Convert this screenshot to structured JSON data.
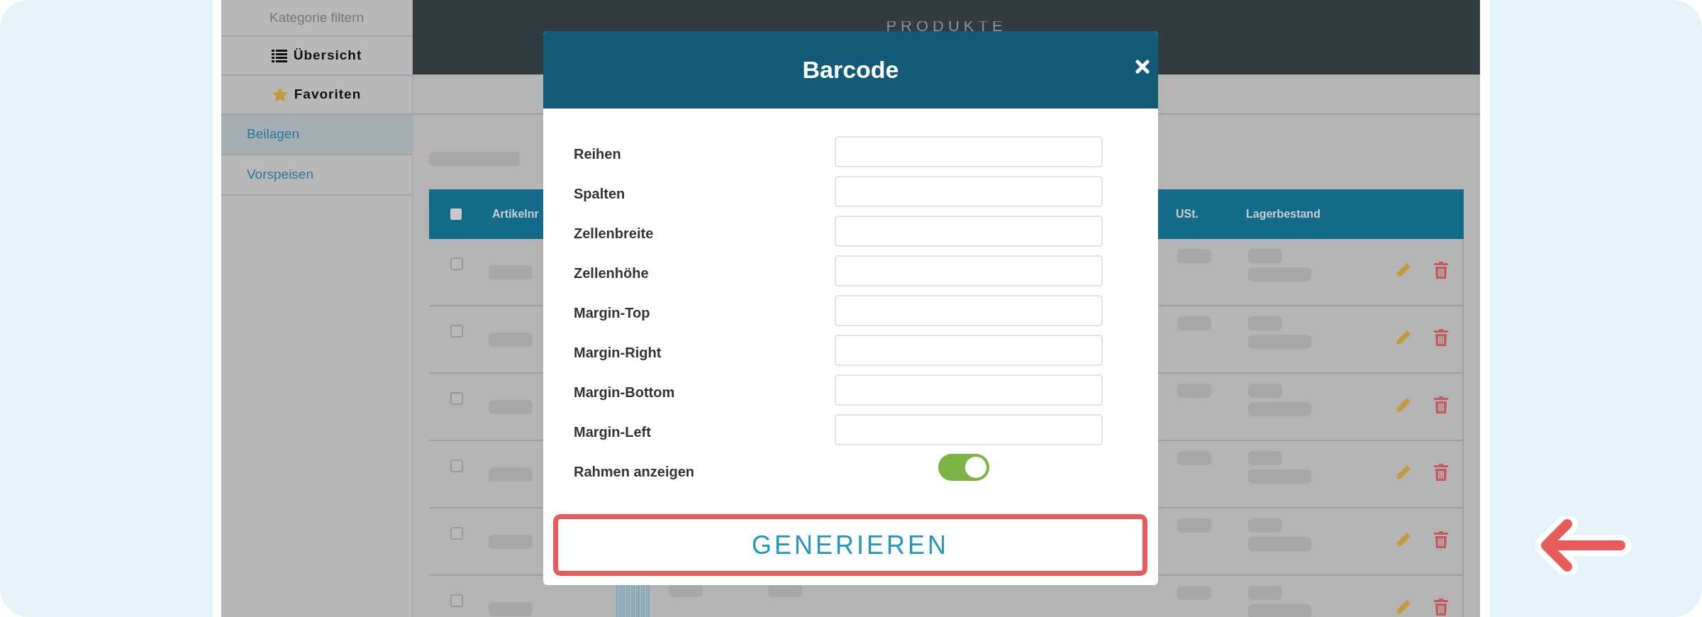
{
  "sidebar": {
    "filter_label": "Kategorie filtern",
    "views": [
      {
        "label": "Übersicht",
        "kind": "list"
      },
      {
        "label": "Favoriten",
        "kind": "star"
      }
    ],
    "categories": [
      {
        "label": "Beilagen",
        "selected": true
      },
      {
        "label": "Vorspeisen",
        "selected": false
      }
    ]
  },
  "header": {
    "title": "PRODUKTE"
  },
  "table": {
    "header_checked": false,
    "columns": [
      "Artikelnr",
      "USt.",
      "Lagerbestand"
    ],
    "rows": [
      {
        "checked": false
      },
      {
        "checked": false
      },
      {
        "checked": false
      },
      {
        "checked": false
      },
      {
        "checked": false
      },
      {
        "checked": false
      }
    ]
  },
  "modal": {
    "title": "Barcode",
    "fields": [
      {
        "label": "Reihen"
      },
      {
        "label": "Spalten"
      },
      {
        "label": "Zellenbreite"
      },
      {
        "label": "Zellenhöhe"
      },
      {
        "label": "Margin-Top"
      },
      {
        "label": "Margin-Right"
      },
      {
        "label": "Margin-Bottom"
      },
      {
        "label": "Margin-Left"
      }
    ],
    "toggle": {
      "label": "Rahmen anzeigen",
      "on": true
    },
    "button": "GENERIEREN"
  }
}
